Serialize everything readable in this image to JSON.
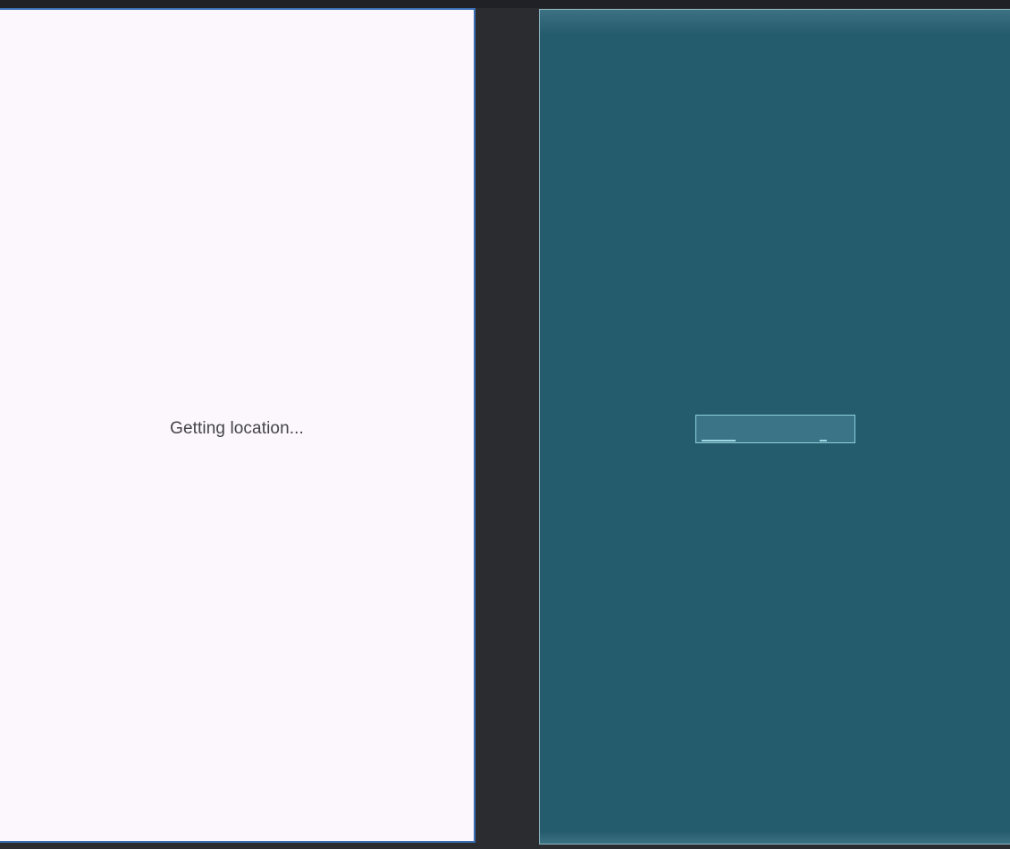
{
  "design_preview": {
    "message": "Getting location..."
  },
  "blueprint_preview": {},
  "colors": {
    "canvas_background": "#2b2c30",
    "design_background": "#fcf6fd",
    "design_border": "#3a6fb5",
    "blueprint_background": "#245b6d",
    "blueprint_outline": "#8fd0dc"
  }
}
